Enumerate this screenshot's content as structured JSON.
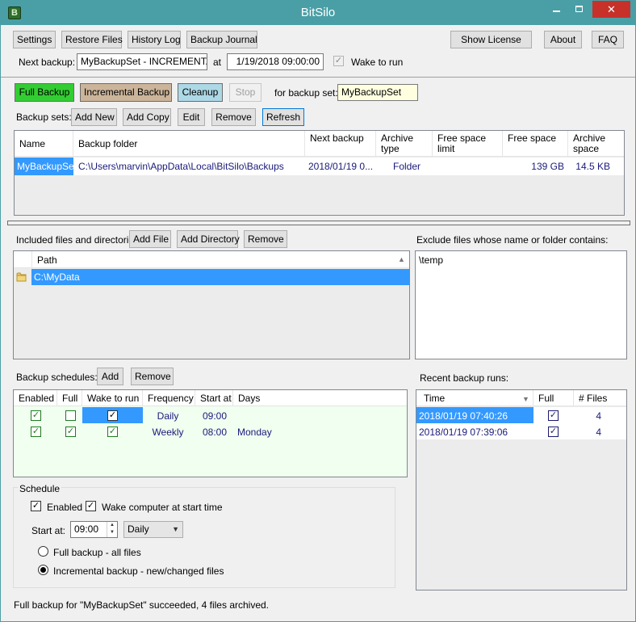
{
  "window": {
    "title": "BitSilo",
    "close_glyph": "✕",
    "icon_letter": "B"
  },
  "toolbar": {
    "settings": "Settings",
    "restore_files": "Restore Files",
    "history_log": "History Log",
    "backup_journal": "Backup Journal",
    "show_license": "Show License",
    "about": "About",
    "faq": "FAQ"
  },
  "next_backup": {
    "label": "Next backup:",
    "value": "MyBackupSet - INCREMENTAL",
    "at_label": "at",
    "datetime": "1/19/2018  09:00:00",
    "wake_label": "Wake to run",
    "wake_checked": true
  },
  "actions": {
    "full_backup": "Full Backup",
    "incremental_backup": "Incremental Backup",
    "cleanup": "Cleanup",
    "stop": "Stop",
    "for_set_label": "for backup set:",
    "for_set_value": "MyBackupSet"
  },
  "backup_sets": {
    "label": "Backup sets:",
    "add_new": "Add New",
    "add_copy": "Add Copy",
    "edit": "Edit",
    "remove": "Remove",
    "refresh": "Refresh",
    "columns": {
      "name": "Name",
      "folder": "Backup folder",
      "next": "Next backup",
      "type": "Archive type",
      "free_limit": "Free space limit",
      "free": "Free space",
      "archive_space": "Archive space"
    },
    "rows": [
      {
        "name": "MyBackupSet",
        "folder": "C:\\Users\\marvin\\AppData\\Local\\BitSilo\\Backups",
        "next": "2018/01/19 0...",
        "type": "Folder",
        "free_limit": "",
        "free": "139 GB",
        "archive_space": "14.5 KB"
      }
    ]
  },
  "included": {
    "label": "Included files and directories:",
    "add_file": "Add File",
    "add_directory": "Add Directory",
    "remove": "Remove",
    "column_path": "Path",
    "items": [
      "C:\\MyData"
    ]
  },
  "exclude": {
    "label": "Exclude files whose name or folder contains:",
    "value": "\\temp"
  },
  "schedules": {
    "label": "Backup schedules:",
    "add": "Add",
    "remove": "Remove",
    "columns": {
      "enabled": "Enabled",
      "full": "Full",
      "wake": "Wake to run",
      "frequency": "Frequency",
      "start": "Start at",
      "days": "Days"
    },
    "rows": [
      {
        "enabled": "✓",
        "full": "",
        "wake": "✓",
        "frequency": "Daily",
        "start": "09:00",
        "days": ""
      },
      {
        "enabled": "✓",
        "full": "✓",
        "wake": "✓",
        "frequency": "Weekly",
        "start": "08:00",
        "days": "Monday"
      }
    ]
  },
  "schedule_group": {
    "title": "Schedule",
    "enabled_label": "Enabled",
    "wake_label": "Wake computer at start time",
    "start_label": "Start at:",
    "start_value": "09:00",
    "frequency_value": "Daily",
    "radio_full": "Full backup - all files",
    "radio_incremental": "Incremental backup - new/changed files",
    "check_glyph": "✓",
    "selected_radio": "incremental"
  },
  "recent": {
    "label": "Recent backup runs:",
    "columns": {
      "time": "Time",
      "full": "Full",
      "files": "# Files"
    },
    "rows": [
      {
        "time": "2018/01/19 07:40:26",
        "full": "✓",
        "files": "4"
      },
      {
        "time": "2018/01/19 07:39:06",
        "full": "✓",
        "files": "4"
      }
    ]
  },
  "status": {
    "message": "Full backup for \"MyBackupSet\" succeeded, 4 files archived."
  },
  "colors": {
    "titlebar": "#4a9fa6",
    "close": "#c7312a",
    "selection": "#3399ff",
    "schedule_bg": "#f0fff0",
    "full_backup": "#32cd32",
    "incremental_backup": "#cbb49a",
    "cleanup": "#add8e6",
    "for_set_bg": "#ffffe0"
  },
  "icons": [
    "app-icon",
    "folder-icon",
    "sort-asc-icon",
    "sort-desc-icon",
    "chevron-down-icon",
    "spin-icon"
  ]
}
